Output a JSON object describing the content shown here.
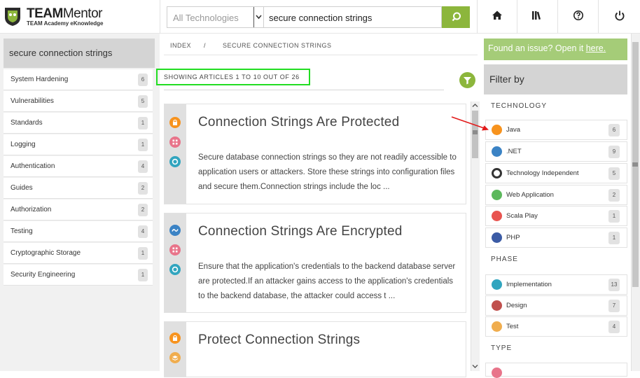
{
  "header": {
    "brand_bold": "TEAM",
    "brand_light": "Mentor",
    "tagline": "TEAM Academy eKnowledge",
    "tech_select_value": "All Technologies",
    "search_value": "secure connection strings",
    "nav_icons": [
      "home-icon",
      "library-icon",
      "help-icon",
      "power-icon"
    ]
  },
  "left": {
    "title": "secure connection strings",
    "items": [
      {
        "label": "System Hardening",
        "count": "6"
      },
      {
        "label": "Vulnerabilities",
        "count": "5"
      },
      {
        "label": "Standards",
        "count": "1"
      },
      {
        "label": "Logging",
        "count": "1"
      },
      {
        "label": "Authentication",
        "count": "4"
      },
      {
        "label": "Guides",
        "count": "2"
      },
      {
        "label": "Authorization",
        "count": "2"
      },
      {
        "label": "Testing",
        "count": "4"
      },
      {
        "label": "Cryptographic Storage",
        "count": "1"
      },
      {
        "label": "Security Engineering",
        "count": "1"
      }
    ]
  },
  "breadcrumb": {
    "index": "INDEX",
    "sep": "/",
    "current": "SECURE CONNECTION STRINGS"
  },
  "results": {
    "showing": "SHOWING ARTICLES 1 TO 10 OUT OF 26"
  },
  "articles": [
    {
      "title": "Connection Strings Are Protected",
      "desc": "Secure database connection strings so they are not readily accessible to application users or attackers. Store these strings into configuration files and secure them.Connection strings include the loc ..."
    },
    {
      "title": "Connection Strings Are Encrypted",
      "desc": "Ensure that the application's credentials to the backend database server are protected.If an attacker gains access to the application's credentials to the backend database, the attacker could access t ..."
    },
    {
      "title": "Protect Connection Strings",
      "desc": ""
    }
  ],
  "right": {
    "issue_text": "Found an issue? Open it ",
    "issue_link": "here.",
    "filter_title": "Filter by",
    "technology_head": "TECHNOLOGY",
    "technology": [
      {
        "label": "Java",
        "count": "6",
        "icon": "java-icon",
        "color": "#f7931e"
      },
      {
        "label": ".NET",
        "count": "9",
        "icon": "dotnet-icon",
        "color": "#3b83c5"
      },
      {
        "label": "Technology Independent",
        "count": "5",
        "icon": "ring-icon",
        "color": "#333333"
      },
      {
        "label": "Web Application",
        "count": "2",
        "icon": "web-app-icon",
        "color": "#5cb85c"
      },
      {
        "label": "Scala Play",
        "count": "1",
        "icon": "scala-icon",
        "color": "#e8534f"
      },
      {
        "label": "PHP",
        "count": "1",
        "icon": "php-icon",
        "color": "#3b5ba5"
      }
    ],
    "phase_head": "PHASE",
    "phase": [
      {
        "label": "Implementation",
        "count": "13",
        "icon": "gear-icon",
        "color": "#31a5bf"
      },
      {
        "label": "Design",
        "count": "7",
        "icon": "design-icon",
        "color": "#c0504d"
      },
      {
        "label": "Test",
        "count": "4",
        "icon": "flask-icon",
        "color": "#f0ad4e"
      }
    ],
    "type_head": "TYPE"
  }
}
